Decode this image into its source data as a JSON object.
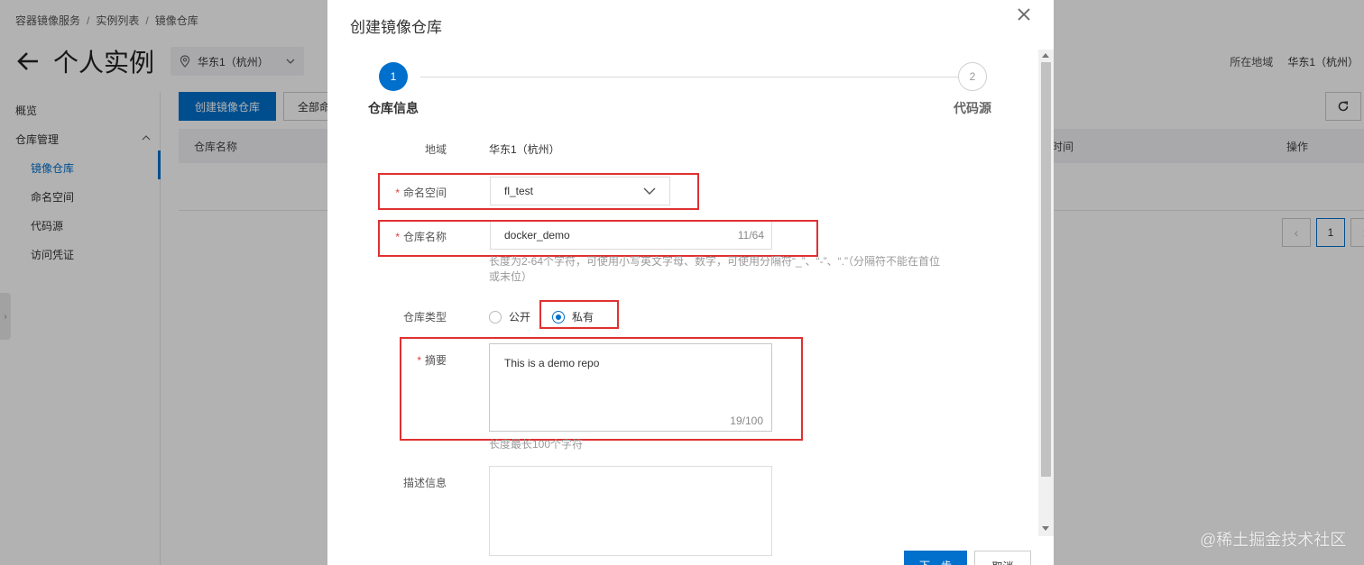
{
  "breadcrumb": [
    "容器镜像服务",
    "实例列表",
    "镜像仓库"
  ],
  "page": {
    "title": "个人实例",
    "region_select": "华东1（杭州）",
    "region_label": "所在地域",
    "region_value": "华东1（杭州）"
  },
  "sidebar": {
    "overview": "概览",
    "repo_mgmt": "仓库管理",
    "items": [
      "镜像仓库",
      "命名空间",
      "代码源",
      "访问凭证"
    ]
  },
  "toolbar": {
    "create_button": "创建镜像仓库",
    "all_button": "全部命"
  },
  "table": {
    "col_name": "仓库名称",
    "col_time": "时间",
    "col_action": "操作"
  },
  "pager": {
    "current": "1"
  },
  "dialog": {
    "title": "创建镜像仓库",
    "steps": [
      {
        "number": "1",
        "label": "仓库信息"
      },
      {
        "number": "2",
        "label": "代码源"
      }
    ],
    "region": {
      "label": "地域",
      "value": "华东1（杭州）"
    },
    "namespace": {
      "label": "命名空间",
      "value": "fl_test"
    },
    "repo_name": {
      "label": "仓库名称",
      "value": "docker_demo",
      "counter": "11/64",
      "hint_line1": "长度为2-64个字符，可使用小写英文字母、数字，可使用分隔符“_”、“-”、“.”（分隔符不能在首位",
      "hint_line2": "或末位）"
    },
    "repo_type": {
      "label": "仓库类型",
      "options": [
        "公开",
        "私有"
      ],
      "selected": "私有"
    },
    "summary": {
      "label": "摘要",
      "value": "This is a demo repo",
      "counter": "19/100",
      "hint": "长度最长100个字符"
    },
    "description": {
      "label": "描述信息",
      "value": ""
    },
    "next_button": "下一步",
    "cancel_button": "取消"
  },
  "watermark": "@稀土掘金技术社区"
}
